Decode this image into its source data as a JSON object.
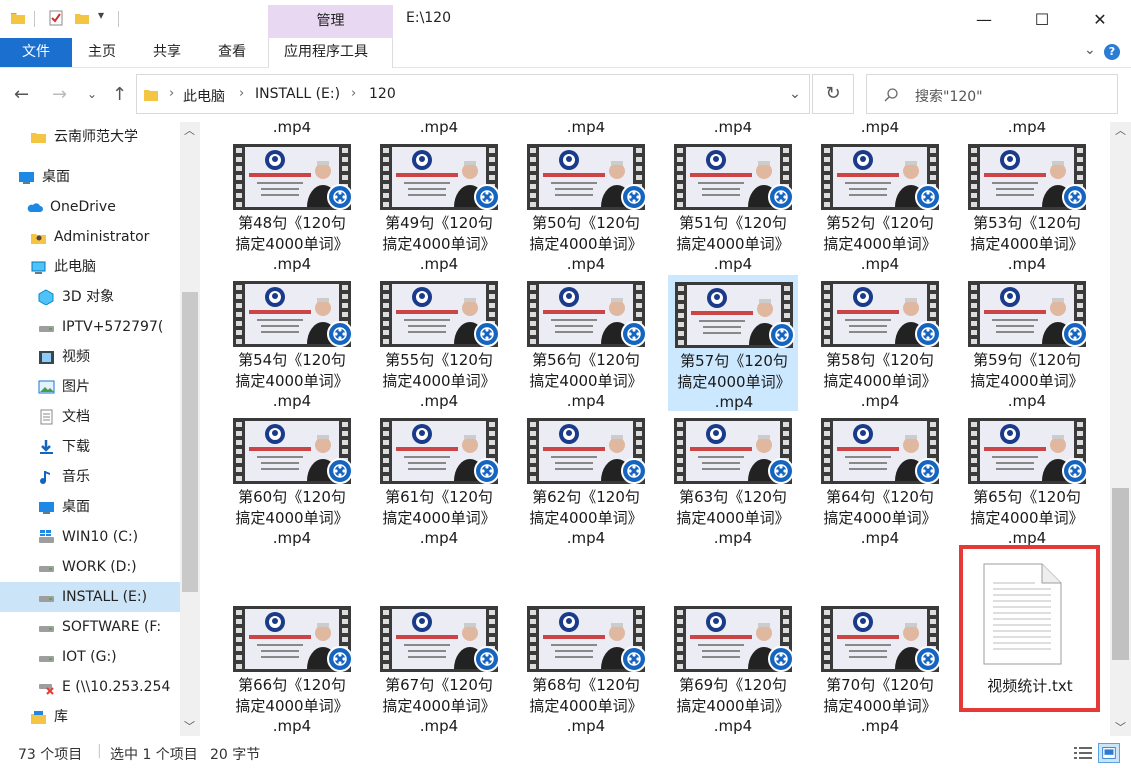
{
  "titlebar": {
    "manage_tab": "管理",
    "window_title": "E:\\120",
    "minimize": "—",
    "maximize": "☐",
    "close": "✕"
  },
  "ribbon": {
    "tabs": [
      "文件",
      "主页",
      "共享",
      "查看",
      "应用程序工具"
    ]
  },
  "address": {
    "breadcrumbs": [
      "此电脑",
      "INSTALL (E:)",
      "120"
    ],
    "search_placeholder": "搜索\"120\""
  },
  "sidebar": {
    "items": [
      {
        "label": "云南师范大学",
        "icon": "folder-icon"
      },
      {
        "label": "桌面",
        "icon": "desktop-icon"
      },
      {
        "label": "OneDrive",
        "icon": "cloud-icon"
      },
      {
        "label": "Administrator",
        "icon": "user-folder-icon"
      },
      {
        "label": "此电脑",
        "icon": "computer-icon"
      },
      {
        "label": "3D 对象",
        "icon": "cube-icon"
      },
      {
        "label": "IPTV+572797(",
        "icon": "drive-icon"
      },
      {
        "label": "视频",
        "icon": "video-icon"
      },
      {
        "label": "图片",
        "icon": "picture-icon"
      },
      {
        "label": "文档",
        "icon": "document-icon"
      },
      {
        "label": "下载",
        "icon": "download-icon"
      },
      {
        "label": "音乐",
        "icon": "music-icon"
      },
      {
        "label": "桌面",
        "icon": "desktop-icon"
      },
      {
        "label": "WIN10 (C:)",
        "icon": "windows-drive-icon"
      },
      {
        "label": "WORK (D:)",
        "icon": "drive-icon"
      },
      {
        "label": "INSTALL (E:)",
        "icon": "drive-icon"
      },
      {
        "label": "SOFTWARE (F:",
        "icon": "drive-icon"
      },
      {
        "label": "IOT (G:)",
        "icon": "drive-icon"
      },
      {
        "label": "E (\\\\10.253.254",
        "icon": "network-drive-disconnected-icon"
      },
      {
        "label": "库",
        "icon": "library-icon"
      }
    ]
  },
  "files": {
    "top_partial_labels": [
      ".mp4",
      ".mp4",
      ".mp4",
      ".mp4",
      ".mp4",
      ".mp4"
    ],
    "rows": [
      [
        {
          "line1": "第48句《120句",
          "line2": "搞定4000单词》",
          "line3": ".mp4"
        },
        {
          "line1": "第49句《120句",
          "line2": "搞定4000单词》",
          "line3": ".mp4"
        },
        {
          "line1": "第50句《120句",
          "line2": "搞定4000单词》",
          "line3": ".mp4"
        },
        {
          "line1": "第51句《120句",
          "line2": "搞定4000单词》",
          "line3": ".mp4"
        },
        {
          "line1": "第52句《120句",
          "line2": "搞定4000单词》",
          "line3": ".mp4"
        },
        {
          "line1": "第53句《120句",
          "line2": "搞定4000单词》",
          "line3": ".mp4"
        }
      ],
      [
        {
          "line1": "第54句《120句",
          "line2": "搞定4000单词》",
          "line3": ".mp4"
        },
        {
          "line1": "第55句《120句",
          "line2": "搞定4000单词》",
          "line3": ".mp4"
        },
        {
          "line1": "第56句《120句",
          "line2": "搞定4000单词》",
          "line3": ".mp4"
        },
        {
          "line1": "第57句《120句",
          "line2": "搞定4000单词》",
          "line3": ".mp4"
        },
        {
          "line1": "第58句《120句",
          "line2": "搞定4000单词》",
          "line3": ".mp4"
        },
        {
          "line1": "第59句《120句",
          "line2": "搞定4000单词》",
          "line3": ".mp4"
        }
      ],
      [
        {
          "line1": "第60句《120句",
          "line2": "搞定4000单词》",
          "line3": ".mp4"
        },
        {
          "line1": "第61句《120句",
          "line2": "搞定4000单词》",
          "line3": ".mp4"
        },
        {
          "line1": "第62句《120句",
          "line2": "搞定4000单词》",
          "line3": ".mp4"
        },
        {
          "line1": "第63句《120句",
          "line2": "搞定4000单词》",
          "line3": ".mp4"
        },
        {
          "line1": "第64句《120句",
          "line2": "搞定4000单词》",
          "line3": ".mp4"
        },
        {
          "line1": "第65句《120句",
          "line2": "搞定4000单词》",
          "line3": ".mp4"
        }
      ],
      [
        {
          "line1": "第66句《120句",
          "line2": "搞定4000单词》",
          "line3": ".mp4"
        },
        {
          "line1": "第67句《120句",
          "line2": "搞定4000单词》",
          "line3": ".mp4"
        },
        {
          "line1": "第68句《120句",
          "line2": "搞定4000单词》",
          "line3": ".mp4"
        },
        {
          "line1": "第69句《120句",
          "line2": "搞定4000单词》",
          "line3": ".mp4"
        },
        {
          "line1": "第70句《120句",
          "line2": "搞定4000单词》",
          "line3": ".mp4"
        }
      ]
    ],
    "text_file": "视频统计.txt",
    "thumb_caption": "《120句搞定4000单词》"
  },
  "status": {
    "count": "73 个项目",
    "selection": "选中 1 个项目",
    "size": "20 字节"
  },
  "colors": {
    "accent": "#1a6fcf",
    "manage_tab": "#e8d8f2",
    "selection": "#cce8ff",
    "highlight_box": "#e53935"
  }
}
